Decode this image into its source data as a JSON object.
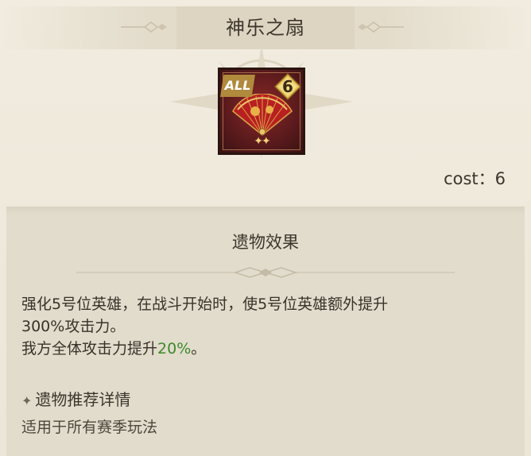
{
  "header": {
    "title": "神乐之扇"
  },
  "relic": {
    "icon": "folding-fan-icon",
    "scope_badge": "ALL",
    "level": "6",
    "stars": "✦✦",
    "cost_label": "cost：6"
  },
  "effect": {
    "section_title": "遗物效果",
    "line1": "强化5号位英雄，在战斗开始时，使5号位英雄额外提升",
    "line2": "300%攻击力。",
    "line3_prefix": "我方全体攻击力提升",
    "line3_value": "20%",
    "line3_suffix": "。"
  },
  "recommend": {
    "icon": "sparkle-star-icon",
    "title": "遗物推荐详情",
    "text": "适用于所有赛季玩法"
  },
  "colors": {
    "background": "#efe9dd",
    "card": "#e2dccd",
    "highlight_green": "#3c8a2a",
    "text": "#3d352b"
  }
}
